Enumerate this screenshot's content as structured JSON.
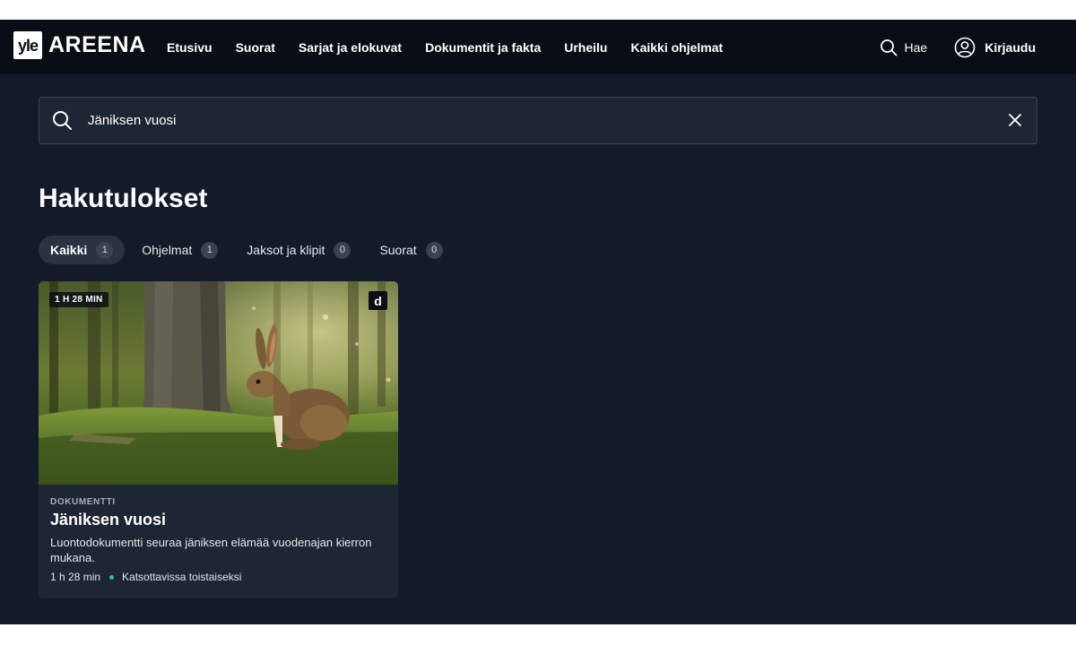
{
  "brand": {
    "yle": "yle",
    "areena": "AREENA"
  },
  "nav": {
    "links": [
      "Etusivu",
      "Suorat",
      "Sarjat ja elokuvat",
      "Dokumentit ja fakta",
      "Urheilu",
      "Kaikki ohjelmat"
    ],
    "search_label": "Hae",
    "login_label": "Kirjaudu"
  },
  "search": {
    "value": "Jäniksen vuosi"
  },
  "page_title": "Hakutulokset",
  "tabs": [
    {
      "label": "Kaikki",
      "count": "1",
      "active": true
    },
    {
      "label": "Ohjelmat",
      "count": "1",
      "active": false
    },
    {
      "label": "Jaksot ja klipit",
      "count": "0",
      "active": false
    },
    {
      "label": "Suorat",
      "count": "0",
      "active": false
    }
  ],
  "result": {
    "duration_badge": "1 H 28 MIN",
    "d_badge": "d",
    "category": "DOKUMENTTI",
    "title": "Jäniksen vuosi",
    "description": "Luontodokumentti seuraa jäniksen elämää vuodenajan kierron mukana.",
    "duration": "1 h 28 min",
    "availability": "Katsottavissa toistaiseksi"
  },
  "colors": {
    "background": "#131a29",
    "nav_bg": "#090d15",
    "card_bg": "#1f2633",
    "availability_dot": "#33c497"
  },
  "icons": [
    "search-icon",
    "user-icon",
    "close-icon"
  ]
}
